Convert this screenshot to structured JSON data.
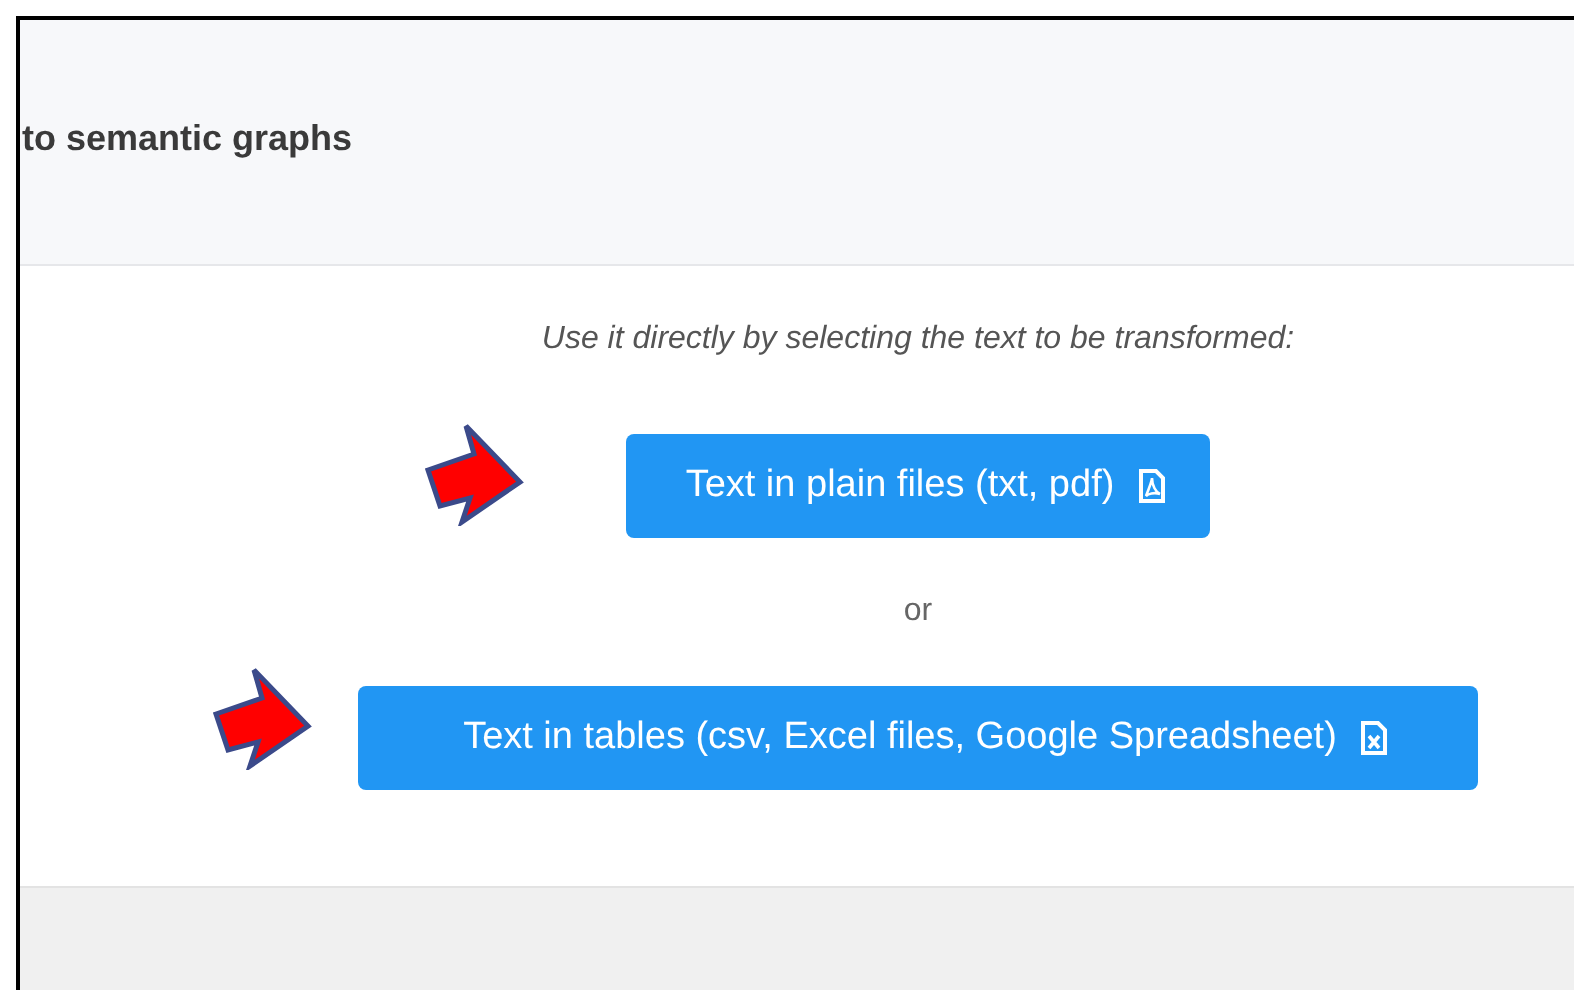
{
  "header": {
    "title": "to semantic graphs"
  },
  "instructions": "Use it directly by selecting the text to be transformed:",
  "buttons": [
    {
      "label": "Text in plain files (txt, pdf)",
      "kind": "pdf",
      "pointed": true
    },
    {
      "label": "Text in tables (csv, Excel files, Google Spreadsheet)",
      "kind": "spreadsheet",
      "pointed": true
    }
  ],
  "separator": "or"
}
